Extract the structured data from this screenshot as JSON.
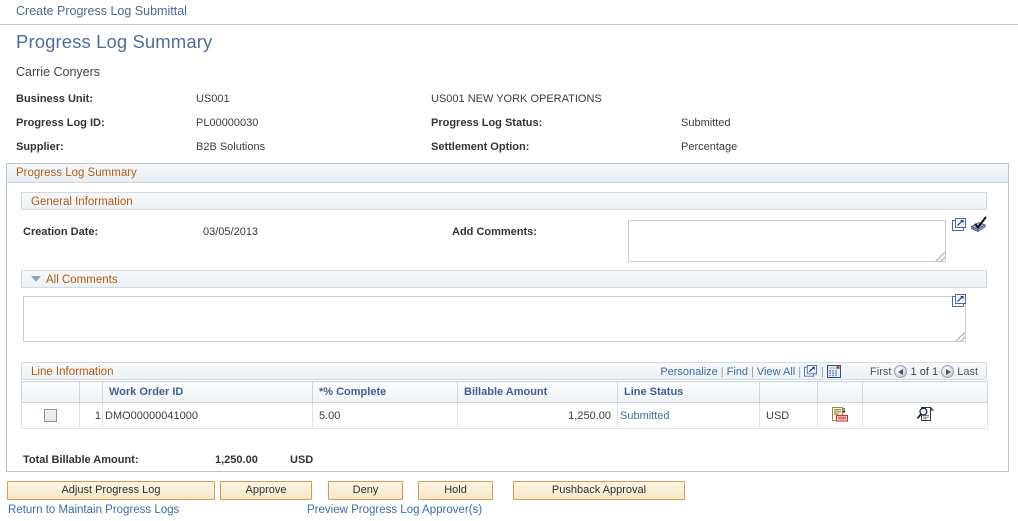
{
  "breadcrumb": {
    "label": "Create Progress Log Submittal"
  },
  "page": {
    "title": "Progress Log Summary",
    "user": "Carrie Conyers"
  },
  "header_fields": {
    "business_unit_label": "Business Unit:",
    "business_unit_value": "US001",
    "business_unit_desc": "US001 NEW YORK OPERATIONS",
    "progress_log_id_label": "Progress Log ID:",
    "progress_log_id_value": "PL00000030",
    "progress_log_status_label": "Progress Log Status:",
    "progress_log_status_value": "Submitted",
    "supplier_label": "Supplier:",
    "supplier_value": "B2B Solutions",
    "settlement_option_label": "Settlement Option:",
    "settlement_option_value": "Percentage"
  },
  "summary_section": {
    "title": "Progress Log Summary",
    "general_information": {
      "title": "General Information",
      "creation_date_label": "Creation Date:",
      "creation_date_value": "03/05/2013",
      "add_comments_label": "Add Comments:",
      "add_comments_value": "",
      "add_comments_placeholder": ""
    },
    "all_comments": {
      "title": "All Comments",
      "value": "",
      "expanded": true
    }
  },
  "line_information": {
    "title": "Line Information",
    "toolbar": {
      "personalize": "Personalize",
      "find": "Find",
      "view_all": "View All",
      "zoom_icon": "expand-grid-icon",
      "download_icon": "download-spreadsheet-icon"
    },
    "pager": {
      "first": "First",
      "last": "Last",
      "position": "1 of 1",
      "prev_icon": "previous-row-icon",
      "next_icon": "next-row-icon"
    },
    "columns": [
      {
        "key": "select",
        "label": ""
      },
      {
        "key": "rownum",
        "label": ""
      },
      {
        "key": "work_order_id",
        "label": "Work Order ID"
      },
      {
        "key": "pct_complete",
        "label": "*% Complete"
      },
      {
        "key": "billable_amount",
        "label": "Billable Amount"
      },
      {
        "key": "line_status",
        "label": "Line Status"
      },
      {
        "key": "currency",
        "label": ""
      },
      {
        "key": "detail_icon",
        "label": ""
      },
      {
        "key": "search_icon",
        "label": ""
      }
    ],
    "rows": [
      {
        "selected": false,
        "rownum": "1",
        "work_order_id": "DMO00000041000",
        "pct_complete": "5.00",
        "billable_amount": "1,250.00",
        "line_status": "Submitted",
        "currency": "USD",
        "detail_icon": "line-details-icon",
        "search_icon": "document-search-icon"
      }
    ],
    "total": {
      "label": "Total Billable Amount:",
      "amount": "1,250.00",
      "currency": "USD"
    }
  },
  "actions": {
    "buttons": [
      {
        "id": "adjust-progress-log",
        "label": "Adjust Progress Log"
      },
      {
        "id": "approve",
        "label": "Approve"
      },
      {
        "id": "deny",
        "label": "Deny"
      },
      {
        "id": "hold",
        "label": "Hold"
      },
      {
        "id": "pushback-approval",
        "label": "Pushback Approval"
      }
    ],
    "links": [
      {
        "id": "return-to-maintain-progress-logs",
        "label": "Return to Maintain Progress Logs"
      },
      {
        "id": "preview-progress-log-approvers",
        "label": "Preview Progress Log Approver(s)"
      }
    ]
  },
  "colors": {
    "section_header_text": "#b55b12",
    "link": "#3b6ea5",
    "title": "#4e6f9e",
    "button_border": "#d39b55",
    "grid_header_text": "#41628f"
  }
}
